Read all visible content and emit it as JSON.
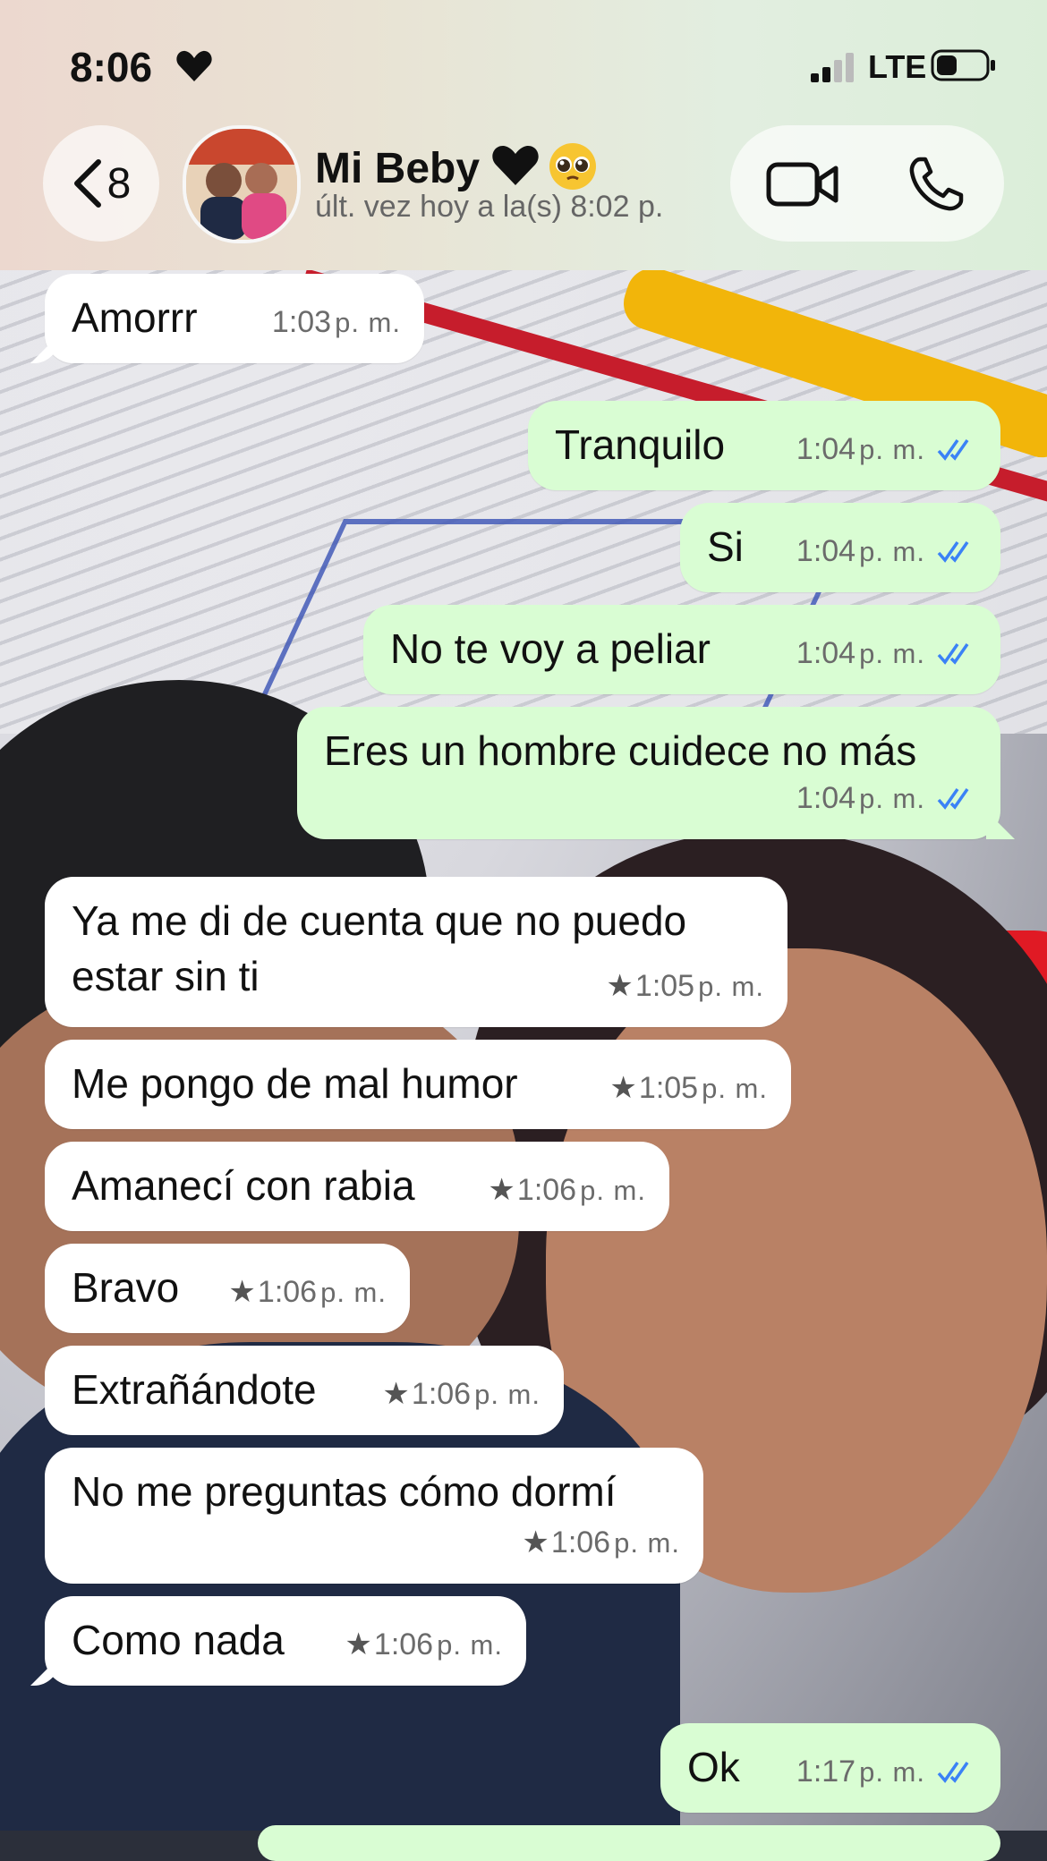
{
  "status_bar": {
    "time": "8:06",
    "network": "LTE"
  },
  "header": {
    "back_count": "8",
    "contact_name": "Mi Beby",
    "last_seen": "últ. vez hoy a la(s) 8:02 p."
  },
  "messages": [
    {
      "direction": "in",
      "text": "Amorrr",
      "time": "1:03",
      "ampm": "p. m."
    },
    {
      "direction": "out",
      "text": "Tranquilo",
      "time": "1:04",
      "ampm": "p. m."
    },
    {
      "direction": "out",
      "text": "Si",
      "time": "1:04",
      "ampm": "p. m."
    },
    {
      "direction": "out",
      "text": "No te voy a peliar",
      "time": "1:04",
      "ampm": "p. m."
    },
    {
      "direction": "out",
      "text": "Eres un hombre cuidece no más",
      "time": "1:04",
      "ampm": "p. m."
    },
    {
      "direction": "in",
      "text": "Ya me di de cuenta que no puedo estar sin ti",
      "time": "1:05",
      "ampm": "p. m.",
      "starred": true
    },
    {
      "direction": "in",
      "text": "Me pongo de mal humor",
      "time": "1:05",
      "ampm": "p. m.",
      "starred": true
    },
    {
      "direction": "in",
      "text": "Amanecí con rabia",
      "time": "1:06",
      "ampm": "p. m.",
      "starred": true
    },
    {
      "direction": "in",
      "text": "Bravo",
      "time": "1:06",
      "ampm": "p. m.",
      "starred": true
    },
    {
      "direction": "in",
      "text": "Extrañándote",
      "time": "1:06",
      "ampm": "p. m.",
      "starred": true
    },
    {
      "direction": "in",
      "text": "No me preguntas cómo dormí",
      "time": "1:06",
      "ampm": "p. m.",
      "starred": true
    },
    {
      "direction": "in",
      "text": "Como nada",
      "time": "1:06",
      "ampm": "p. m.",
      "starred": true
    },
    {
      "direction": "out",
      "text": "Ok",
      "time": "1:17",
      "ampm": "p. m."
    }
  ],
  "colors": {
    "incoming_bubble": "#ffffff",
    "outgoing_bubble": "#d9fdd3",
    "read_ticks": "#3b82f6"
  },
  "icons": {
    "status_heart": "heart-icon",
    "back": "chevron-left-icon",
    "video": "video-camera-icon",
    "phone": "phone-icon",
    "read_receipt": "double-check-icon",
    "starred": "star-icon"
  }
}
